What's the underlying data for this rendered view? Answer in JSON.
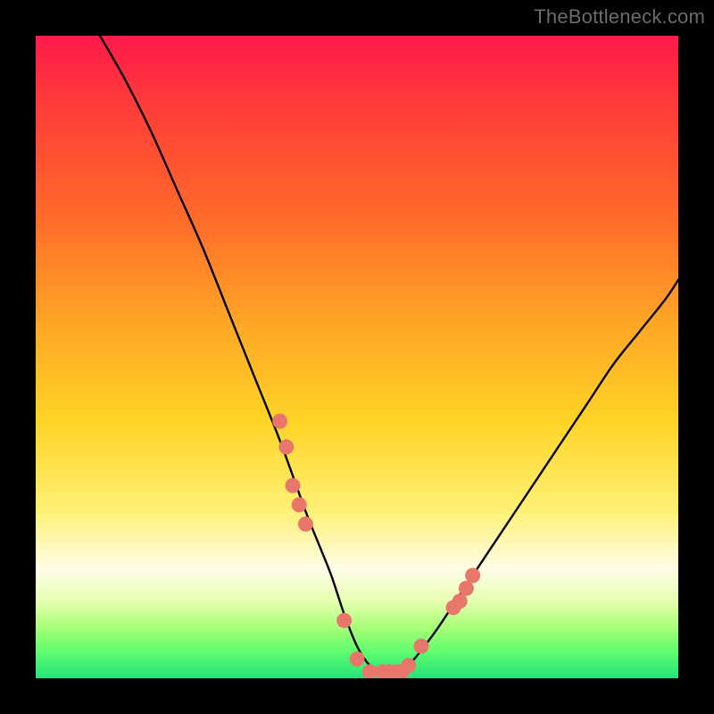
{
  "watermark": "TheBottleneck.com",
  "chart_data": {
    "type": "line",
    "title": "",
    "xlabel": "",
    "ylabel": "",
    "xlim": [
      0,
      100
    ],
    "ylim": [
      0,
      100
    ],
    "series": [
      {
        "name": "bottleneck-curve",
        "x": [
          10,
          14,
          18,
          22,
          26,
          30,
          34,
          38,
          42,
          44,
          46,
          48,
          50,
          52,
          54,
          56,
          58,
          62,
          66,
          70,
          74,
          78,
          82,
          86,
          90,
          94,
          98,
          100
        ],
        "values": [
          100,
          93,
          85,
          76,
          67,
          57,
          47,
          37,
          26,
          21,
          16,
          10,
          5,
          2,
          1,
          1,
          2,
          7,
          13,
          19,
          25,
          31,
          37,
          43,
          49,
          54,
          59,
          62
        ]
      }
    ],
    "markers": {
      "name": "highlight-dots",
      "color": "#e8766b",
      "x": [
        38,
        39,
        40,
        41,
        42,
        48,
        50,
        52,
        54,
        55,
        56,
        57,
        58,
        60,
        65,
        66,
        67,
        68
      ],
      "values": [
        40,
        36,
        30,
        27,
        24,
        9,
        3,
        1,
        1,
        1,
        1,
        1,
        2,
        5,
        11,
        12,
        14,
        16
      ]
    },
    "gradient_stops": [
      {
        "pos": 0,
        "color": "#ff1a4b"
      },
      {
        "pos": 10,
        "color": "#ff3a3a"
      },
      {
        "pos": 28,
        "color": "#ff6a2a"
      },
      {
        "pos": 45,
        "color": "#ffa726"
      },
      {
        "pos": 60,
        "color": "#ffd426"
      },
      {
        "pos": 74,
        "color": "#fff176"
      },
      {
        "pos": 83,
        "color": "#fffde7"
      },
      {
        "pos": 88,
        "color": "#e6ffb0"
      },
      {
        "pos": 92,
        "color": "#a8ff78"
      },
      {
        "pos": 96,
        "color": "#5dfc6e"
      },
      {
        "pos": 100,
        "color": "#22e37a"
      }
    ]
  }
}
